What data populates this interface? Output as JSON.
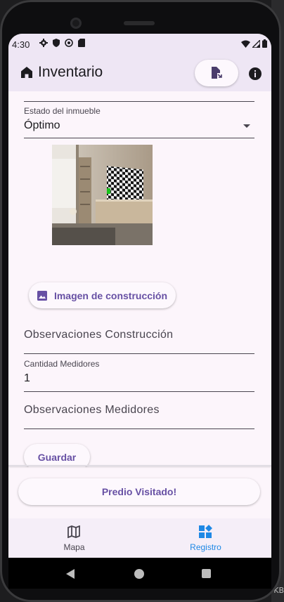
{
  "status_bar": {
    "time": "4:30",
    "icons": [
      "settings-icon",
      "shield-icon",
      "vpn-icon",
      "sd-card-icon"
    ],
    "right_icons": [
      "wifi-icon",
      "signal-icon",
      "battery-icon"
    ]
  },
  "app_bar": {
    "title": "Inventario",
    "icons": [
      "home-icon",
      "file-export-icon",
      "info-icon"
    ]
  },
  "form": {
    "estado_label": "Estado del inmueble",
    "estado_value": "Óptimo",
    "image_button_label": "Imagen de construcción",
    "observaciones_construccion_placeholder": "Observaciones Construcción",
    "cantidad_medidores_label": "Cantidad Medidores",
    "cantidad_medidores_value": "1",
    "observaciones_medidores_placeholder": "Observaciones Medidores",
    "save_button_label": "Guardar"
  },
  "predio_button_label": "Predio Visitado!",
  "bottom_nav": {
    "items": [
      {
        "label": "Mapa",
        "icon": "map-icon",
        "selected": false
      },
      {
        "label": "Registro",
        "icon": "dashboard-icon",
        "selected": true
      }
    ]
  },
  "colors": {
    "primary": "#6750a4",
    "nav_selected": "#1e88e5",
    "app_bar": "#eee6f4",
    "surface": "#fcf5fb"
  },
  "right_edge_text": "KB"
}
